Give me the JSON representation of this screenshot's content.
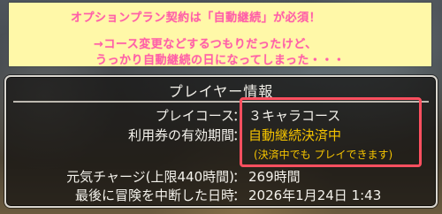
{
  "caption": {
    "line1": "オプションプラン契約は「自動継続」が必須！",
    "line2": "→コース変更などするつもりだったけど、",
    "line3": "うっかり自動継続の日になってしまった・・・"
  },
  "panel": {
    "title": "プレイヤー情報",
    "rows": [
      {
        "label": "プレイコース",
        "colon": "：",
        "value": "３キャラコース"
      },
      {
        "label": "利用券の有効期間",
        "colon": "：",
        "value": "自動継続決済中"
      },
      {
        "label": "元気チャージ(上限440時間)",
        "colon": "：",
        "value": "269時間"
      },
      {
        "label": "最後に冒険を中断した日時",
        "colon": "：",
        "value": "2026年1月24日  1:43"
      }
    ],
    "note": "(決済中でも プレイできます)"
  },
  "colors": {
    "caption_bg": "#fff8a8",
    "caption_text": "#ff5fa8",
    "highlight_border": "#ff4f5f",
    "gold_text": "#f5c400",
    "panel_text": "#f4f2ec"
  }
}
